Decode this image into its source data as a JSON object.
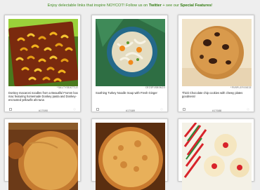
{
  "banner": {
    "part1": "Enjoy delectable links that inspire NOYCOT! Follow us on ",
    "twitter": "Twitter",
    "part2": " + see our ",
    "special": "Special Features",
    "part3": "!"
  },
  "cards": [
    {
      "credit": "*SALTYSEATTLE",
      "caption": "Donkey macaroni noodles from a Beautiful Fromm box mac featuring homemade Donkey pasta and Donkey-encrusted yellowfin ahi-tuna",
      "id": "#17690",
      "icon": "heart-icon"
    },
    {
      "credit": "CRISPUSBONIO",
      "caption": "Soothing Turkey Noodle Soup with Fresh Ginger",
      "id": "#17689",
      "icon": "heart-icon"
    },
    {
      "credit": "*PURPLEFOODIE",
      "caption": "Thick Chocolate chip cookies with chewy plates goodness!",
      "id": "#17688",
      "icon": "heart-icon"
    }
  ]
}
